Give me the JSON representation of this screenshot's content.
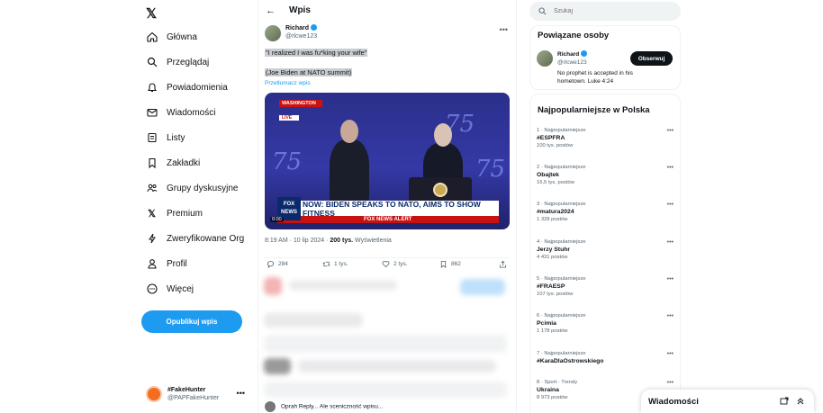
{
  "sidebar": {
    "nav": [
      {
        "label": "Główna",
        "icon": "home-icon"
      },
      {
        "label": "Przeglądaj",
        "icon": "search-icon"
      },
      {
        "label": "Powiadomienia",
        "icon": "bell-icon"
      },
      {
        "label": "Wiadomości",
        "icon": "mail-icon"
      },
      {
        "label": "Listy",
        "icon": "list-icon"
      },
      {
        "label": "Zakładki",
        "icon": "bookmark-icon"
      },
      {
        "label": "Grupy dyskusyjne",
        "icon": "community-icon"
      },
      {
        "label": "Premium",
        "icon": "x-logo-icon"
      },
      {
        "label": "Zweryfikowane Org",
        "icon": "lightning-icon"
      },
      {
        "label": "Profil",
        "icon": "profile-icon"
      },
      {
        "label": "Więcej",
        "icon": "more-circle-icon"
      }
    ],
    "post_button": "Opublikuj wpis",
    "account": {
      "name": "#FakeHunter",
      "handle": "@PAPFakeHunter"
    }
  },
  "header": {
    "title": "Wpis"
  },
  "tweet": {
    "author_name": "Richard",
    "author_handle": "@rlcwe123",
    "line1": "\"I realized I was fu*king your wife\"",
    "line2": "(Joe Biden at NATO summit)",
    "translate": "Przetłumacz wpis",
    "video": {
      "location_tag": "WASHINGTON",
      "live_tag": "LIVE",
      "banner": "NOW: BIDEN SPEAKS TO NATO, AIMS TO SHOW FITNESS",
      "sub_banner": "FOX NEWS ALERT",
      "network": "FOX NEWS",
      "timecode": "0:00",
      "stage_logo": "75"
    },
    "time": "8:19 AM · 10 lip 2024",
    "views_count": "200 tys.",
    "views_label": "Wyświetlenia",
    "actions": {
      "replies": "284",
      "reposts": "1 tys.",
      "likes": "2 tys.",
      "bookmarks": "862"
    }
  },
  "reply_preview": "Oprah Reply... Ale sceniczność wpisu...",
  "right": {
    "search_placeholder": "Szukaj",
    "related_title": "Powiązane osoby",
    "related": {
      "name": "Richard",
      "handle": "@rlcwe123",
      "bio": "No prophet is accepted in his hometown. Luke 4:24",
      "follow": "Obserwuj"
    },
    "trends_title": "Najpopularniejsze w Polska",
    "trends": [
      {
        "ctx": "1 · Najpopularniejsze",
        "name": "#ESPFRA",
        "count": "100 tys. postów"
      },
      {
        "ctx": "2 · Najpopularniejsze",
        "name": "Obajtek",
        "count": "16,5 tys. postów"
      },
      {
        "ctx": "3 · Najpopularniejsze",
        "name": "#matura2024",
        "count": "1 328 postów"
      },
      {
        "ctx": "4 · Najpopularniejsze",
        "name": "Jerzy Stuhr",
        "count": "4 431 postów"
      },
      {
        "ctx": "5 · Najpopularniejsze",
        "name": "#FRAESP",
        "count": "107 tys. postów"
      },
      {
        "ctx": "6 · Najpopularniejsze",
        "name": "Pcimia",
        "count": "1 178 postów"
      },
      {
        "ctx": "7 · Najpopularniejsze",
        "name": "#KaraDlaOstrowskiego",
        "count": ""
      },
      {
        "ctx": "8 · Sport · Trendy",
        "name": "Ukraina",
        "count": "8 973 postów"
      }
    ]
  },
  "drawer": {
    "title": "Wiadomości"
  }
}
